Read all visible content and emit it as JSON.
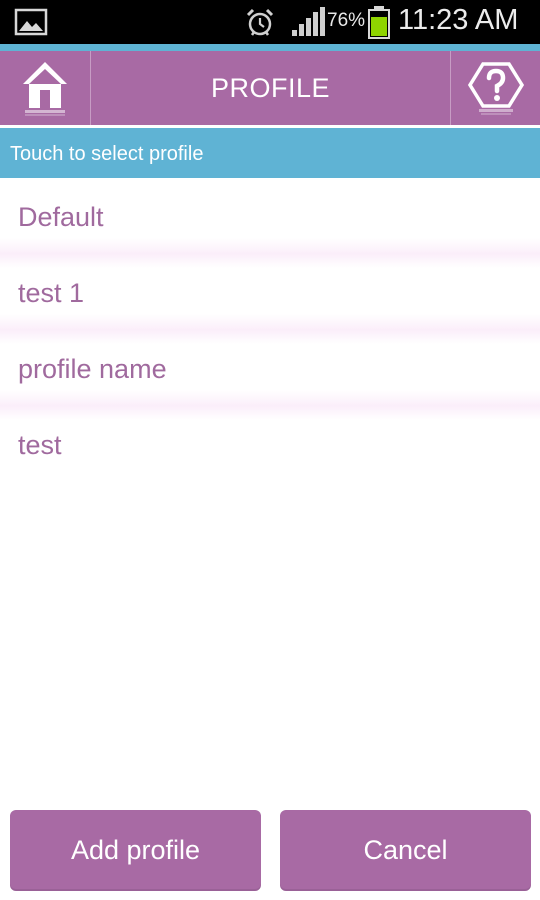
{
  "status_bar": {
    "battery_percent": "76%",
    "time": "11:23 AM",
    "icons": [
      "gallery-icon",
      "alarm-icon",
      "signal-icon",
      "battery-icon"
    ]
  },
  "header": {
    "title": "PROFILE",
    "home_icon": "home-icon",
    "help_icon": "help-icon"
  },
  "subheader": {
    "text": "Touch to select profile"
  },
  "profiles": [
    {
      "label": "Default"
    },
    {
      "label": "test 1"
    },
    {
      "label": "profile name"
    },
    {
      "label": "test"
    }
  ],
  "actions": {
    "add_label": "Add profile",
    "cancel_label": "Cancel"
  },
  "colors": {
    "primary": "#a86aa4",
    "accent": "#5fb3d4",
    "item_text": "#a06a9e",
    "battery": "#8fd400"
  }
}
